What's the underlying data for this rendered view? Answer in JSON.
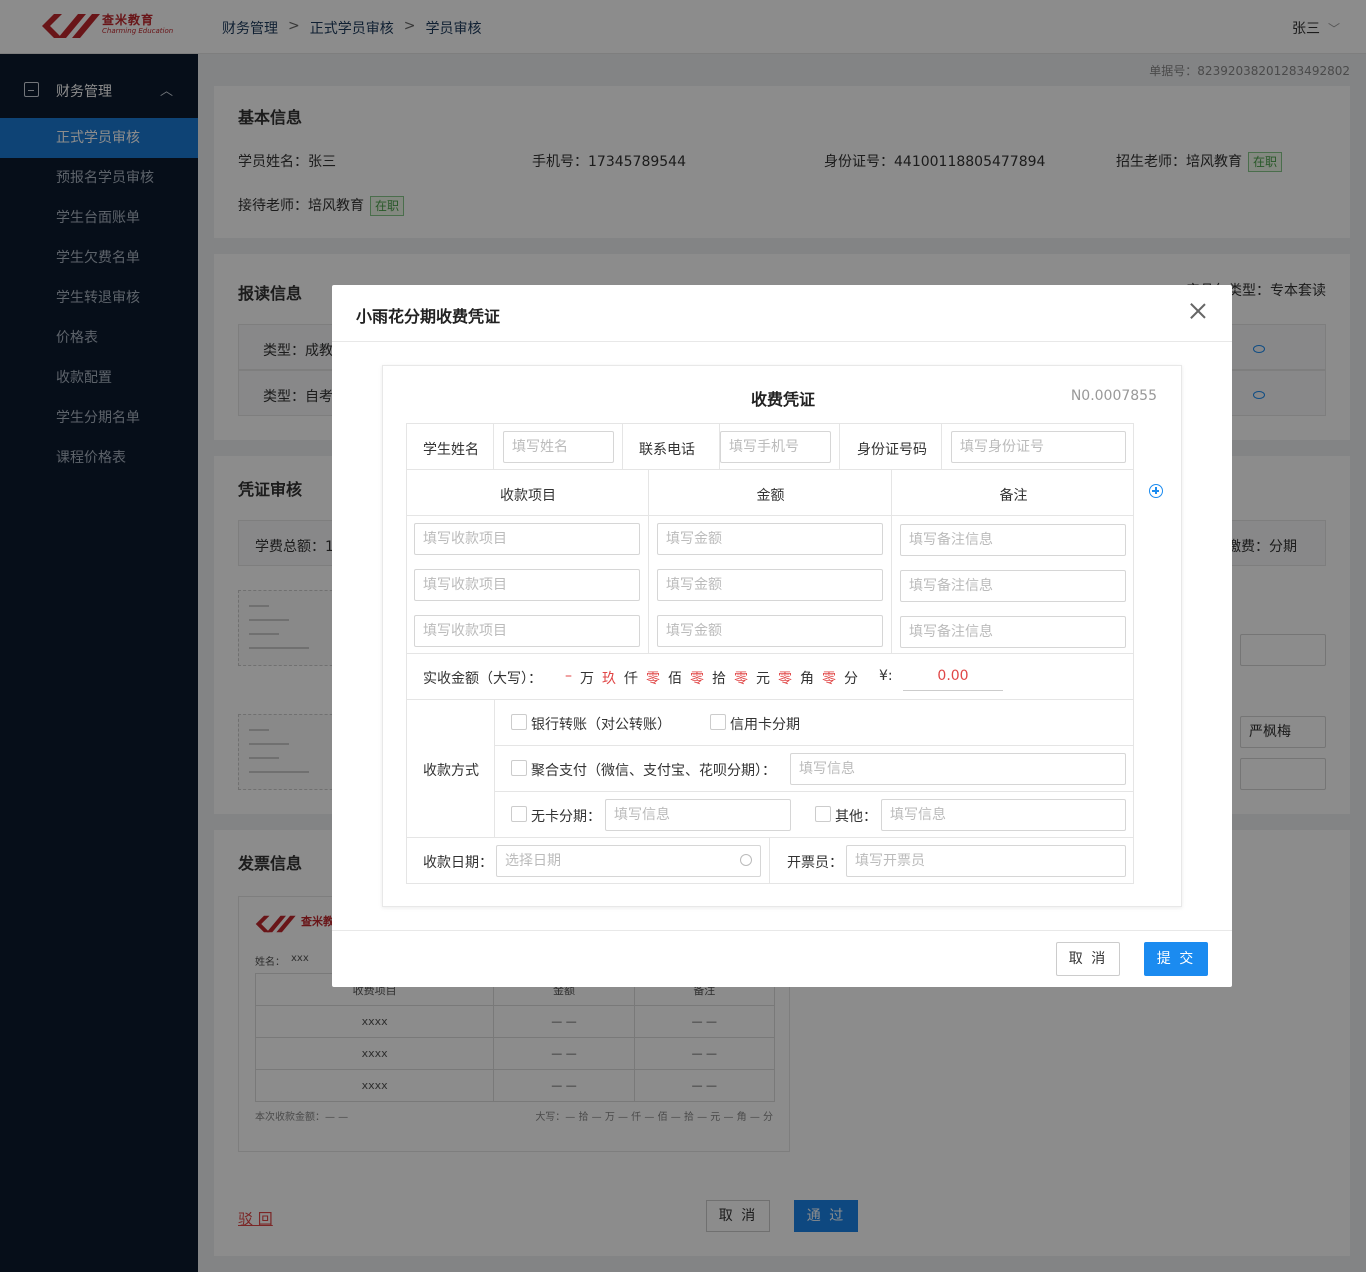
{
  "header": {
    "logo_cn": "查米教育",
    "logo_en": "Charming Education",
    "breadcrumb": [
      "财务管理",
      "正式学员审核",
      "学员审核"
    ],
    "user": "张三"
  },
  "sidebar": {
    "group": "财务管理",
    "items": [
      "正式学员审核",
      "预报名学员审核",
      "学生台面账单",
      "学生欠费名单",
      "学生转退审核",
      "价格表",
      "收款配置",
      "学生分期名单",
      "课程价格表"
    ]
  },
  "doc_no": "单据号：82392038201283492802",
  "basic": {
    "title": "基本信息",
    "name": "学员姓名：张三",
    "phone": "手机号：17345789544",
    "id": "身份证号：44100118805477894",
    "recruiter": "招生老师：培风教育",
    "receptionist": "接待老师：培风教育",
    "status": "在职"
  },
  "enroll": {
    "title": "报读信息",
    "type_note": "产品包类型：专本套读",
    "row1": "类型：成教",
    "row2": "类型：自考"
  },
  "voucher_review": {
    "title": "凭证审核",
    "total": "学费总额：1(",
    "plan": "缴费：分期",
    "person": "严枫梅"
  },
  "invoice": {
    "title": "发票信息",
    "name": "姓名：",
    "name_val": "xxx",
    "headers": [
      "收费项目",
      "金额",
      "备注"
    ],
    "rows": [
      [
        "xxxx",
        "— —",
        "— —"
      ],
      [
        "xxxx",
        "— —",
        "— —"
      ],
      [
        "xxxx",
        "— —",
        "— —"
      ]
    ],
    "footer_left": "本次收款金额：— —",
    "footer_right": "大写：— 拾 — 万 — 仟 — 佰 — 拾 — 元 — 角 — 分"
  },
  "actions": {
    "reject": "驳 回",
    "cancel": "取 消",
    "pass": "通 过"
  },
  "modal": {
    "title": "小雨花分期收费凭证",
    "voucher_title": "收费凭证",
    "voucher_no": "N0.0007855",
    "student_name": "学生姓名",
    "student_name_ph": "填写姓名",
    "phone": "联系电话",
    "phone_ph": "填写手机号",
    "id": "身份证号码",
    "id_ph": "填写身份证号",
    "col_item": "收款项目",
    "col_amount": "金额",
    "col_note": "备注",
    "item_ph": "填写收款项目",
    "amount_ph": "填写金额",
    "note_ph": "填写备注信息",
    "actual_label": "实收金额（大写）：",
    "amount_words": [
      {
        "v": "–",
        "red": true
      },
      {
        "v": "万",
        "red": false
      },
      {
        "v": "玖",
        "red": true
      },
      {
        "v": "仟",
        "red": false
      },
      {
        "v": "零",
        "red": true
      },
      {
        "v": "佰",
        "red": false
      },
      {
        "v": "零",
        "red": true
      },
      {
        "v": "拾",
        "red": false
      },
      {
        "v": "零",
        "red": true
      },
      {
        "v": "元",
        "red": false
      },
      {
        "v": "零",
        "red": true
      },
      {
        "v": "角",
        "red": false
      },
      {
        "v": "零",
        "red": true
      },
      {
        "v": "分",
        "red": false
      }
    ],
    "yen": "¥:",
    "amount_value": "0.00",
    "pay_method": "收款方式",
    "opt_bank": "银行转账（对公转账）",
    "opt_credit": "信用卡分期",
    "opt_agg": "聚合支付（微信、支付宝、花呗分期）：",
    "info_ph": "填写信息",
    "opt_nocard": "无卡分期：",
    "opt_other": "其他：",
    "date_label": "收款日期：",
    "date_ph": "选择日期",
    "issuer_label": "开票员：",
    "issuer_ph": "填写开票员",
    "cancel": "取 消",
    "submit": "提 交"
  },
  "colors": {
    "primary": "#1b84ea",
    "sidebar": "#0b1a2e",
    "danger": "#e04646",
    "success": "#4aa04a"
  }
}
